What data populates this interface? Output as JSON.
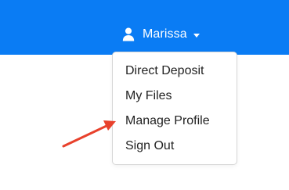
{
  "header": {
    "background_color": "#0a7cf4",
    "user_menu": {
      "icon": "user-icon",
      "name": "Marissa",
      "caret_icon": "caret-down-icon"
    }
  },
  "dropdown": {
    "items": [
      {
        "label": "Direct Deposit"
      },
      {
        "label": "My Files"
      },
      {
        "label": "Manage Profile"
      },
      {
        "label": "Sign Out"
      }
    ]
  },
  "annotation": {
    "type": "arrow",
    "color": "#e8412c",
    "points_to": "Manage Profile"
  }
}
